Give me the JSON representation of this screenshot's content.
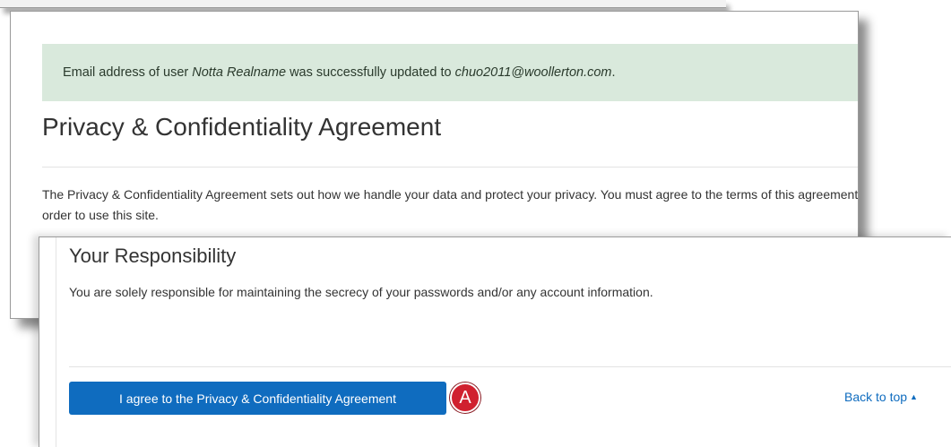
{
  "alert": {
    "prefix": "Email address of user ",
    "user_name": "Notta Realname",
    "middle": " was successfully updated to ",
    "email": "chuo2011@woollerton.com",
    "suffix": "."
  },
  "page": {
    "title": "Privacy & Confidentiality Agreement",
    "intro": "The Privacy & Confidentiality Agreement sets out how we handle your data and protect your privacy. You must agree to the terms of this agreement in order to use this site."
  },
  "responsibility": {
    "title": "Your Responsibility",
    "text": "You are solely responsible for maintaining the secrecy of your passwords and/or any account information."
  },
  "actions": {
    "agree_label": "I agree to the Privacy & Confidentiality Agreement",
    "callout_letter": "A",
    "back_to_top_label": "Back to top",
    "back_to_top_icon": "caret-up-icon"
  },
  "colors": {
    "alert_bg": "#d9e9dc",
    "primary": "#0f6cbf",
    "callout": "#d0202f"
  }
}
